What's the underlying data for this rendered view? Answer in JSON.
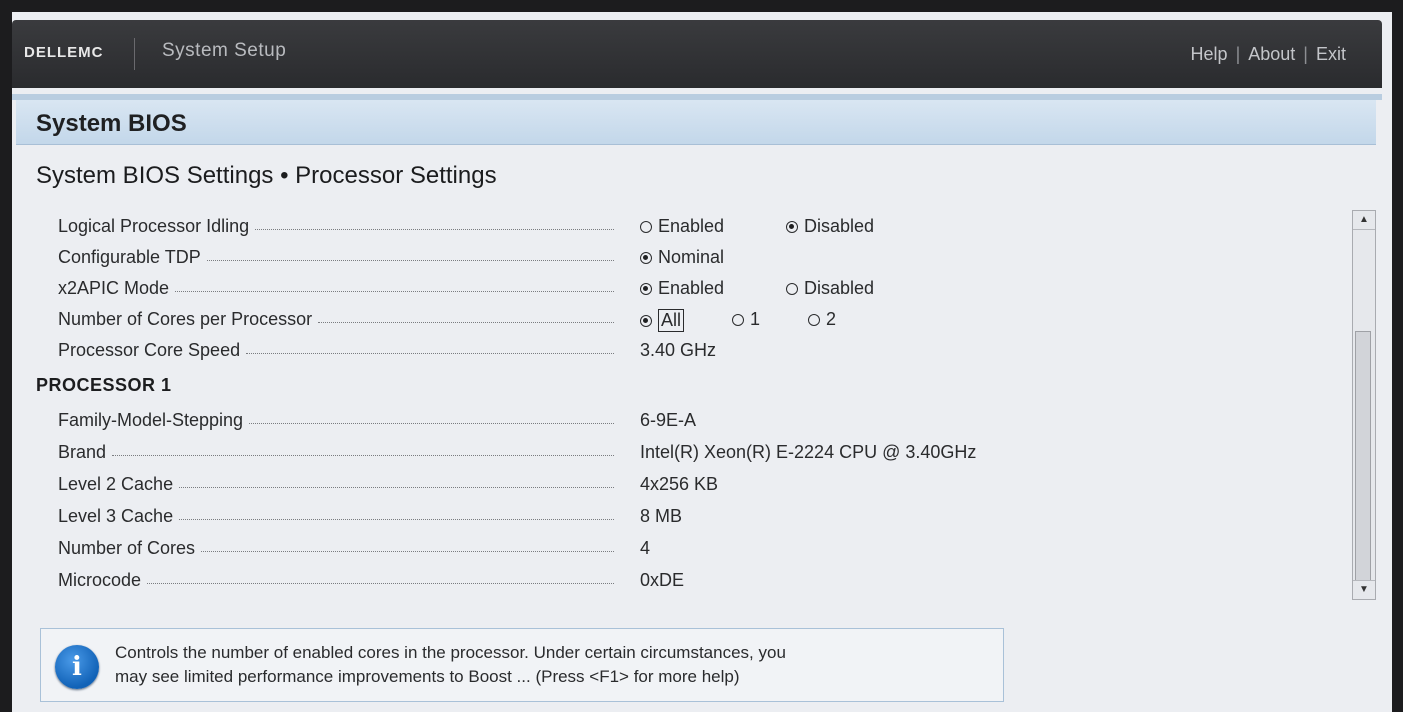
{
  "header": {
    "logo": "DELLEMC",
    "app_title": "System Setup",
    "links": {
      "help": "Help",
      "about": "About",
      "exit": "Exit",
      "sep": "|"
    }
  },
  "band": {
    "title": "System BIOS"
  },
  "page": {
    "subtitle": "System BIOS Settings • Processor Settings"
  },
  "settings": {
    "logical_idling": {
      "label": "Logical Processor Idling",
      "opt1": "Enabled",
      "opt2": "Disabled",
      "selected": "Disabled"
    },
    "configurable_tdp": {
      "label": "Configurable TDP",
      "opt1": "Nominal",
      "selected": "Nominal"
    },
    "x2apic": {
      "label": "x2APIC Mode",
      "opt1": "Enabled",
      "opt2": "Disabled",
      "selected": "Enabled"
    },
    "cores_per_proc": {
      "label": "Number of Cores per Processor",
      "opt1": "All",
      "opt2": "1",
      "opt3": "2",
      "selected": "All"
    },
    "core_speed": {
      "label": "Processor Core Speed",
      "value": "3.40 GHz"
    }
  },
  "processor1": {
    "heading": "PROCESSOR 1",
    "family": {
      "label": "Family-Model-Stepping",
      "value": "6-9E-A"
    },
    "brand": {
      "label": "Brand",
      "value": "Intel(R) Xeon(R) E-2224 CPU @ 3.40GHz"
    },
    "l2": {
      "label": "Level 2 Cache",
      "value": "4x256 KB"
    },
    "l3": {
      "label": "Level 3 Cache",
      "value": "8 MB"
    },
    "cores": {
      "label": "Number of Cores",
      "value": "4"
    },
    "microcode": {
      "label": "Microcode",
      "value": "0xDE"
    }
  },
  "help": {
    "line1": "Controls the number of enabled cores in the processor. Under certain circumstances, you",
    "line2": "may see limited performance improvements to Boost ... (Press <F1> for more help)"
  },
  "colors": {
    "header_bg": "#2e2f32",
    "band_bg": "#c9dcee",
    "info_icon": "#1a6fc4"
  }
}
